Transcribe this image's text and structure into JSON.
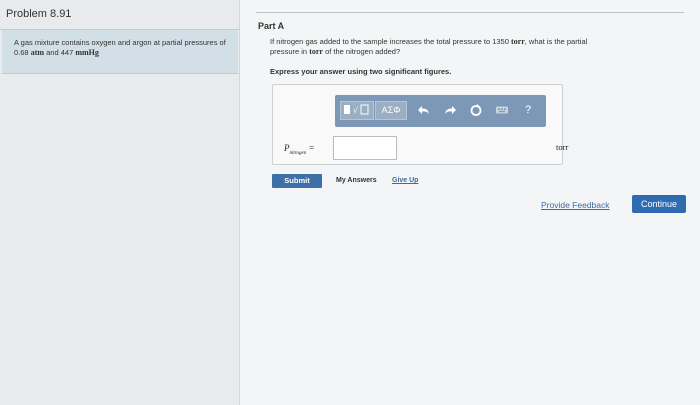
{
  "problem": {
    "title": "Problem 8.91",
    "statement_prefix": "A gas mixture contains oxygen and argon at partial pressures of 0.68",
    "unit_atm": "atm",
    "statement_mid": "and 447",
    "unit_mmhg": "mmHg"
  },
  "part": {
    "label": "Part A",
    "question_line1_a": "If nitrogen gas added to the sample increases the total pressure to 1350",
    "unit_torr": "torr",
    "question_line1_b": ", what is the partial",
    "question_line2_a": "pressure in",
    "question_line2_b": "of the nitrogen added?",
    "instruction": "Express your answer using two significant figures."
  },
  "answer": {
    "variable_symbol": "P",
    "variable_subscript": "nitrogen",
    "equals": "=",
    "value": "",
    "unit": "torr"
  },
  "toolbar": {
    "templates_icon": "template-icon",
    "greek_label": "ΑΣΦ",
    "undo_icon": "undo-icon",
    "redo_icon": "redo-icon",
    "reset_icon": "reset-icon",
    "keyboard_icon": "keyboard-icon",
    "help_label": "?",
    "color": "#7d98b6"
  },
  "actions": {
    "submit": "Submit",
    "my_answers": "My Answers",
    "give_up": "Give Up",
    "provide_feedback": "Provide Feedback",
    "continue": "Continue"
  },
  "colors": {
    "problem_box": "#d2dfe6",
    "link": "#3e6aa0",
    "primary": "#2f6bb0"
  }
}
